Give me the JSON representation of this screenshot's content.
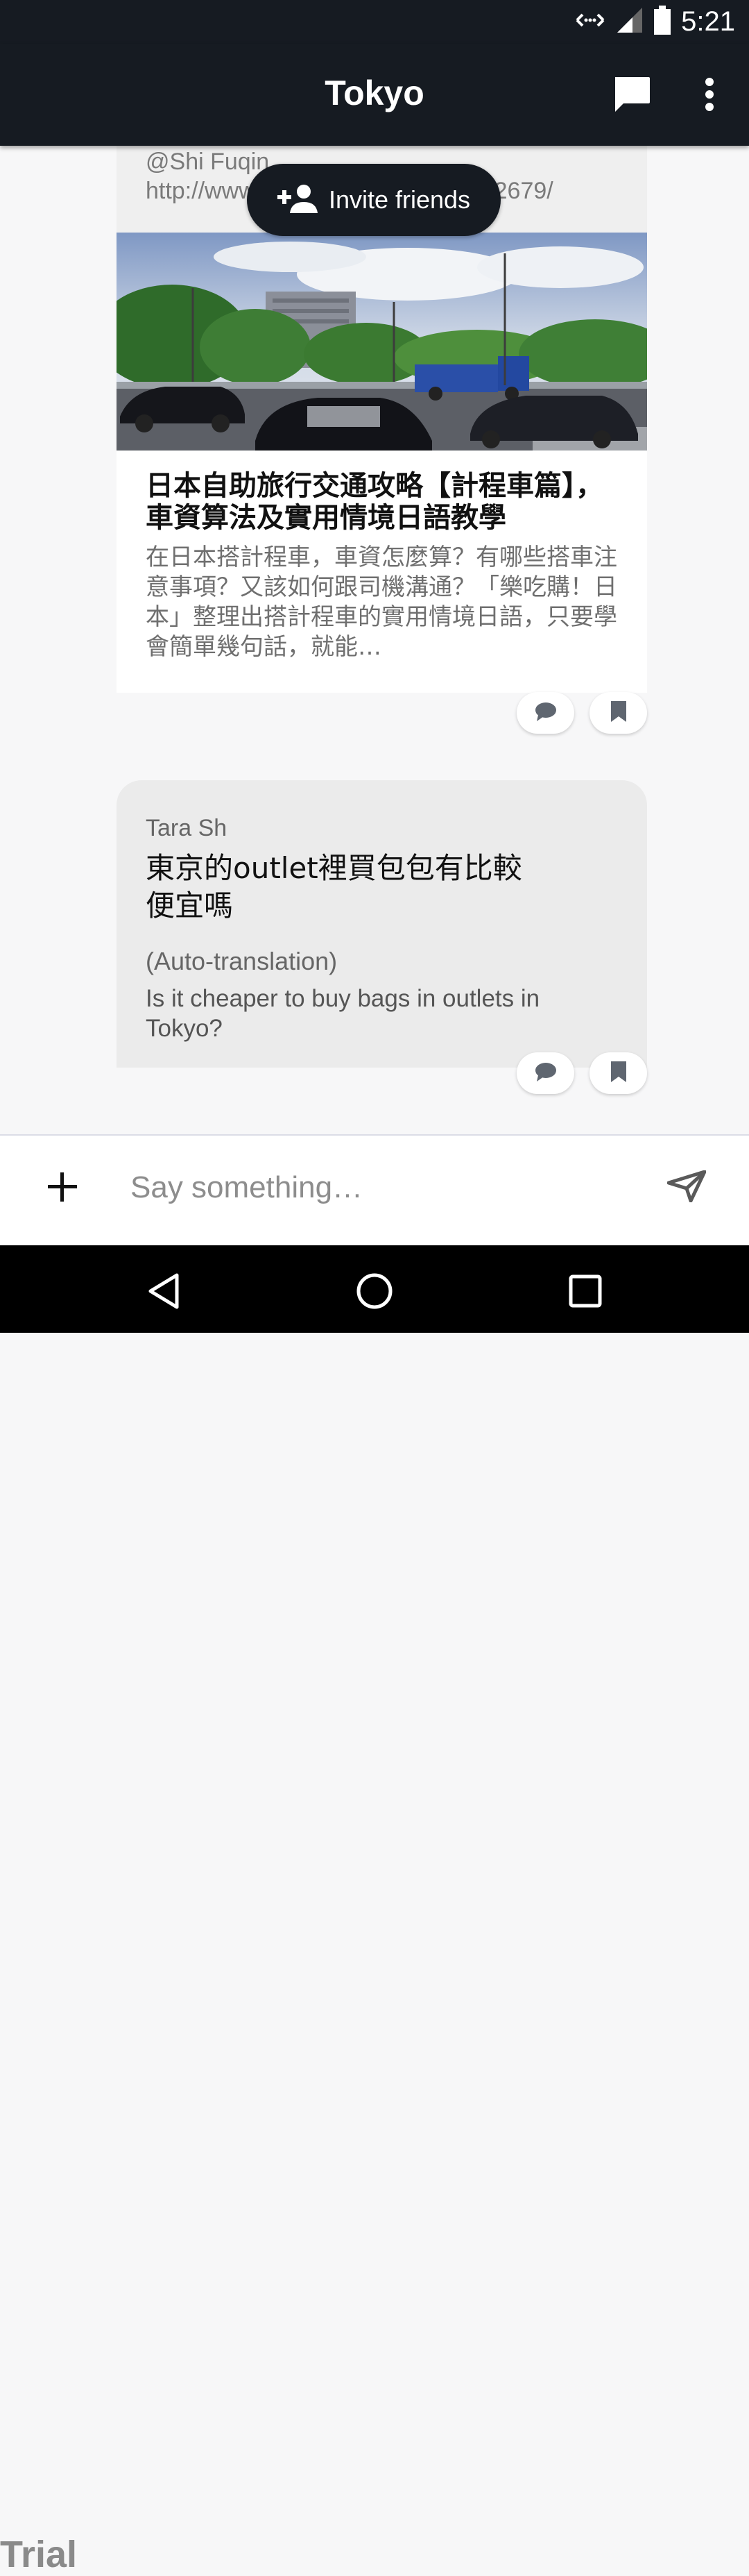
{
  "status_bar": {
    "time": "5:21"
  },
  "app_bar": {
    "title": "Tokyo",
    "chat_icon": "chat-bubble-icon",
    "more_icon": "more-vert-icon"
  },
  "invite": {
    "label": "Invite friends",
    "icon": "person-add-icon"
  },
  "post1": {
    "mention": "@Shi Fuqin",
    "url": "http://www.letsgojp.com/archives/2679/",
    "title": "日本自助旅行交通攻略【計程車篇】，車資算法及實用情境日語教學",
    "description": "在日本搭計程車，車資怎麼算？有哪些搭車注意事項？又該如何跟司機溝通？「樂吃購！日本」整理出搭計程車的實用情境日語，只要學會簡單幾句話，就能…",
    "actions": [
      "comment-icon",
      "bookmark-icon"
    ]
  },
  "post2": {
    "author": "Tara Sh",
    "message": "東京的outlet裡買包包有比較便宜嗎",
    "auto_label": "(Auto-translation)",
    "translation": "Is it cheaper to buy bags in outlets in Tokyo?",
    "actions": [
      "comment-icon",
      "bookmark-icon"
    ]
  },
  "composer": {
    "placeholder": "Say something…"
  },
  "watermark": "Trial"
}
